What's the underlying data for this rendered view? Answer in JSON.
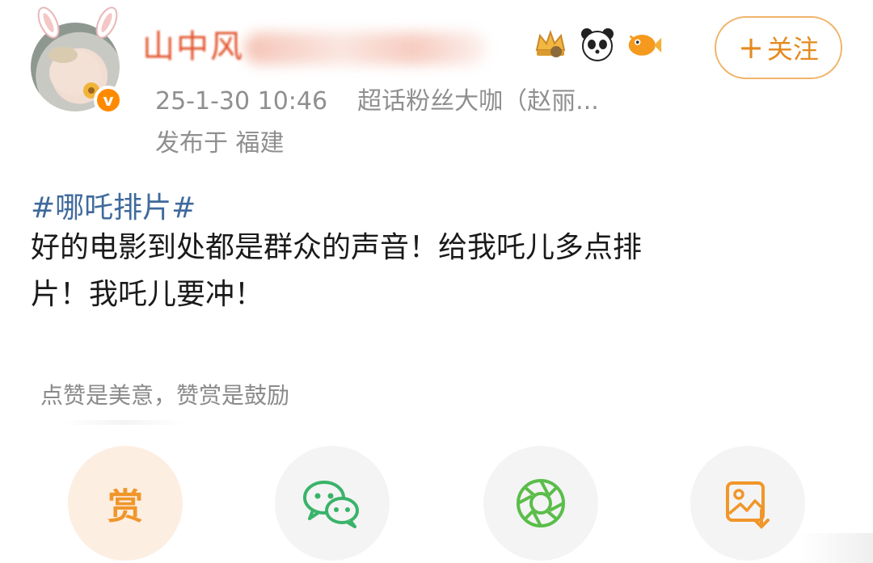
{
  "post": {
    "username_visible": "山中风",
    "timestamp": "25-1-30 10:46",
    "fan_badge": "超话粉丝大咖（赵丽...",
    "location_label": "发布于",
    "location": "福建",
    "follow_label": "关注",
    "follow_plus": "+",
    "hashtag": "#哪吒排片#",
    "content_line1": "好的电影到处都是群众的声音！给我吒儿多点排",
    "content_line2": "片！我吒儿要冲！",
    "verified_mark": "v"
  },
  "reward_tip": "点赞是美意，赞赏是鼓励",
  "actions": {
    "reward_label": "赏"
  },
  "colors": {
    "username": "#e2562e",
    "follow_border": "#f0b46a",
    "follow_text": "#e58a1f",
    "hashtag": "#3f6a9c",
    "wechat": "#3ab36a",
    "moments": "#5bbd4a",
    "save": "#f0962a"
  },
  "icons": [
    "crown-badge-icon",
    "panda-icon",
    "fish-icon",
    "wechat-icon",
    "moments-icon",
    "save-image-icon"
  ]
}
